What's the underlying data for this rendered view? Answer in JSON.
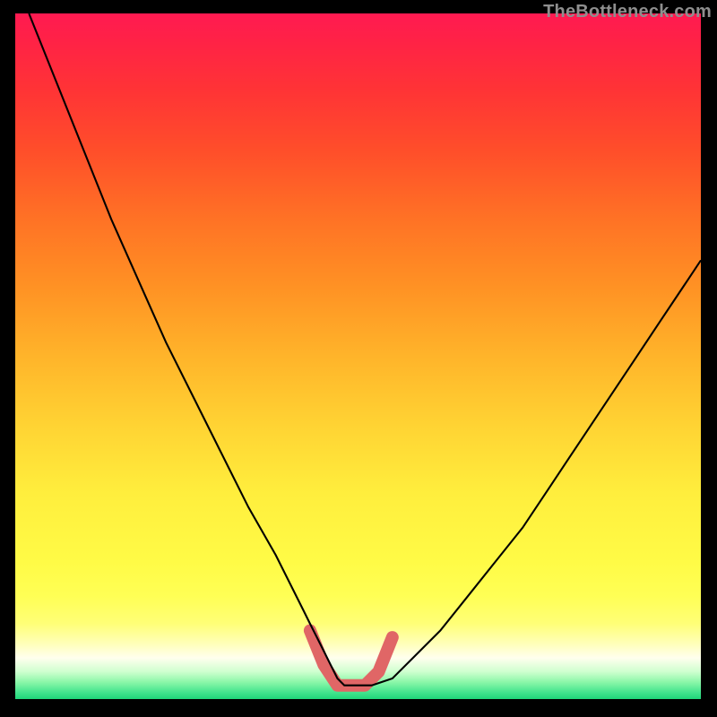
{
  "watermark": "TheBottleneck.com",
  "chart_data": {
    "type": "line",
    "title": "",
    "xlabel": "",
    "ylabel": "",
    "xlim": [
      0,
      100
    ],
    "ylim": [
      0,
      100
    ],
    "series": [
      {
        "name": "curve",
        "x": [
          2,
          6,
          10,
          14,
          18,
          22,
          26,
          30,
          34,
          38,
          42,
          43,
          44,
          45,
          46,
          47,
          48,
          49,
          52,
          55,
          58,
          62,
          66,
          70,
          74,
          78,
          82,
          86,
          90,
          94,
          98,
          100
        ],
        "y": [
          100,
          90,
          80,
          70,
          61,
          52,
          44,
          36,
          28,
          21,
          13,
          11,
          9,
          7,
          5,
          3,
          2,
          2,
          2,
          3,
          6,
          10,
          15,
          20,
          25,
          31,
          37,
          43,
          49,
          55,
          61,
          64
        ]
      }
    ],
    "highlight": {
      "name": "bottleneck-region",
      "x": [
        43,
        45,
        47,
        49,
        51,
        53,
        55
      ],
      "y": [
        10,
        5,
        2,
        2,
        2,
        4,
        9
      ]
    },
    "gradient_stops": [
      {
        "pos": 0.0,
        "color": "#ff1a51"
      },
      {
        "pos": 0.3,
        "color": "#ff7225"
      },
      {
        "pos": 0.6,
        "color": "#ffd333"
      },
      {
        "pos": 0.85,
        "color": "#ffff55"
      },
      {
        "pos": 0.94,
        "color": "#ffffee"
      },
      {
        "pos": 1.0,
        "color": "#1fd679"
      }
    ]
  }
}
